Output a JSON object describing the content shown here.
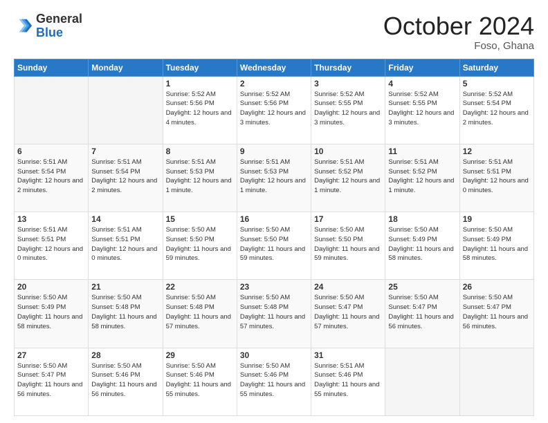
{
  "header": {
    "logo_general": "General",
    "logo_blue": "Blue",
    "month": "October 2024",
    "location": "Foso, Ghana"
  },
  "weekdays": [
    "Sunday",
    "Monday",
    "Tuesday",
    "Wednesday",
    "Thursday",
    "Friday",
    "Saturday"
  ],
  "weeks": [
    [
      {
        "day": "",
        "info": ""
      },
      {
        "day": "",
        "info": ""
      },
      {
        "day": "1",
        "info": "Sunrise: 5:52 AM\nSunset: 5:56 PM\nDaylight: 12 hours and 4 minutes."
      },
      {
        "day": "2",
        "info": "Sunrise: 5:52 AM\nSunset: 5:56 PM\nDaylight: 12 hours and 3 minutes."
      },
      {
        "day": "3",
        "info": "Sunrise: 5:52 AM\nSunset: 5:55 PM\nDaylight: 12 hours and 3 minutes."
      },
      {
        "day": "4",
        "info": "Sunrise: 5:52 AM\nSunset: 5:55 PM\nDaylight: 12 hours and 3 minutes."
      },
      {
        "day": "5",
        "info": "Sunrise: 5:52 AM\nSunset: 5:54 PM\nDaylight: 12 hours and 2 minutes."
      }
    ],
    [
      {
        "day": "6",
        "info": "Sunrise: 5:51 AM\nSunset: 5:54 PM\nDaylight: 12 hours and 2 minutes."
      },
      {
        "day": "7",
        "info": "Sunrise: 5:51 AM\nSunset: 5:54 PM\nDaylight: 12 hours and 2 minutes."
      },
      {
        "day": "8",
        "info": "Sunrise: 5:51 AM\nSunset: 5:53 PM\nDaylight: 12 hours and 1 minute."
      },
      {
        "day": "9",
        "info": "Sunrise: 5:51 AM\nSunset: 5:53 PM\nDaylight: 12 hours and 1 minute."
      },
      {
        "day": "10",
        "info": "Sunrise: 5:51 AM\nSunset: 5:52 PM\nDaylight: 12 hours and 1 minute."
      },
      {
        "day": "11",
        "info": "Sunrise: 5:51 AM\nSunset: 5:52 PM\nDaylight: 12 hours and 1 minute."
      },
      {
        "day": "12",
        "info": "Sunrise: 5:51 AM\nSunset: 5:51 PM\nDaylight: 12 hours and 0 minutes."
      }
    ],
    [
      {
        "day": "13",
        "info": "Sunrise: 5:51 AM\nSunset: 5:51 PM\nDaylight: 12 hours and 0 minutes."
      },
      {
        "day": "14",
        "info": "Sunrise: 5:51 AM\nSunset: 5:51 PM\nDaylight: 12 hours and 0 minutes."
      },
      {
        "day": "15",
        "info": "Sunrise: 5:50 AM\nSunset: 5:50 PM\nDaylight: 11 hours and 59 minutes."
      },
      {
        "day": "16",
        "info": "Sunrise: 5:50 AM\nSunset: 5:50 PM\nDaylight: 11 hours and 59 minutes."
      },
      {
        "day": "17",
        "info": "Sunrise: 5:50 AM\nSunset: 5:50 PM\nDaylight: 11 hours and 59 minutes."
      },
      {
        "day": "18",
        "info": "Sunrise: 5:50 AM\nSunset: 5:49 PM\nDaylight: 11 hours and 58 minutes."
      },
      {
        "day": "19",
        "info": "Sunrise: 5:50 AM\nSunset: 5:49 PM\nDaylight: 11 hours and 58 minutes."
      }
    ],
    [
      {
        "day": "20",
        "info": "Sunrise: 5:50 AM\nSunset: 5:49 PM\nDaylight: 11 hours and 58 minutes."
      },
      {
        "day": "21",
        "info": "Sunrise: 5:50 AM\nSunset: 5:48 PM\nDaylight: 11 hours and 58 minutes."
      },
      {
        "day": "22",
        "info": "Sunrise: 5:50 AM\nSunset: 5:48 PM\nDaylight: 11 hours and 57 minutes."
      },
      {
        "day": "23",
        "info": "Sunrise: 5:50 AM\nSunset: 5:48 PM\nDaylight: 11 hours and 57 minutes."
      },
      {
        "day": "24",
        "info": "Sunrise: 5:50 AM\nSunset: 5:47 PM\nDaylight: 11 hours and 57 minutes."
      },
      {
        "day": "25",
        "info": "Sunrise: 5:50 AM\nSunset: 5:47 PM\nDaylight: 11 hours and 56 minutes."
      },
      {
        "day": "26",
        "info": "Sunrise: 5:50 AM\nSunset: 5:47 PM\nDaylight: 11 hours and 56 minutes."
      }
    ],
    [
      {
        "day": "27",
        "info": "Sunrise: 5:50 AM\nSunset: 5:47 PM\nDaylight: 11 hours and 56 minutes."
      },
      {
        "day": "28",
        "info": "Sunrise: 5:50 AM\nSunset: 5:46 PM\nDaylight: 11 hours and 56 minutes."
      },
      {
        "day": "29",
        "info": "Sunrise: 5:50 AM\nSunset: 5:46 PM\nDaylight: 11 hours and 55 minutes."
      },
      {
        "day": "30",
        "info": "Sunrise: 5:50 AM\nSunset: 5:46 PM\nDaylight: 11 hours and 55 minutes."
      },
      {
        "day": "31",
        "info": "Sunrise: 5:51 AM\nSunset: 5:46 PM\nDaylight: 11 hours and 55 minutes."
      },
      {
        "day": "",
        "info": ""
      },
      {
        "day": "",
        "info": ""
      }
    ]
  ]
}
